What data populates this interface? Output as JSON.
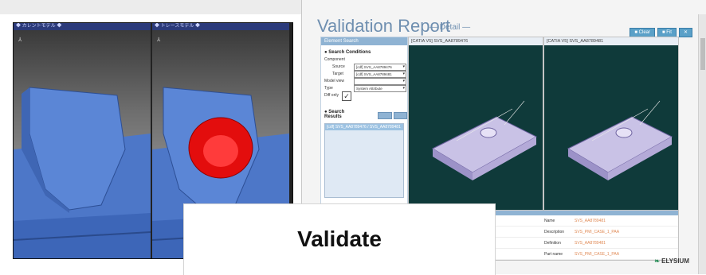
{
  "viewer": {
    "left_title": "◆ カレントモデル ◆",
    "right_title": "◆ トレースモデル ◆",
    "face_color": "#5b86d6",
    "highlight_color": "#e30d0d"
  },
  "report": {
    "title": "Validation Report",
    "subtitle": "— Detail —",
    "toolbar": [
      "■ Clear",
      "■ Fit",
      "✕"
    ],
    "sidebar": {
      "header": "Element Search",
      "conditions_title": "● Search Conditions",
      "component_label": "Component",
      "source_label": "Source",
      "source_value": "[cdf] SVS_AA8789476",
      "target_label": "Target",
      "target_value": "[cdf] SVS_AA8789481",
      "model_view_label": "Model view",
      "model_view_value": "",
      "type_label": "Type",
      "type_value": "System Attribute",
      "diff_only_label": "Diff only",
      "results_title": "● Search Results",
      "result_item": "[cdf] SVS_AA8789476 / SVS_AA8789481"
    },
    "view_a_header": "[CATIA V5] SVS_AA8789476",
    "view_b_header": "[CATIA V5] SVS_AA8789481",
    "properties": [
      {
        "name": "Name",
        "value": "SVS_AA8789481"
      },
      {
        "name": "Description",
        "value": "SVS_PMI_CASE_1_PAA"
      },
      {
        "name": "Definition",
        "value": "SVS_AA8789481"
      },
      {
        "name": "Part name",
        "value": "SVS_PMI_CASE_1_PAA"
      }
    ],
    "brand": "ELYSIUM",
    "brand_mark": "❧"
  },
  "overlay": {
    "label": "Validate"
  }
}
